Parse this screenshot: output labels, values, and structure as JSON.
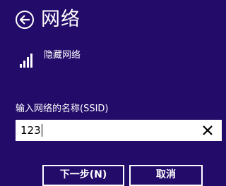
{
  "header": {
    "title": "网络",
    "back_icon": "back-arrow-icon"
  },
  "network": {
    "name": "隐藏网络",
    "signal_icon": "wifi-signal-icon"
  },
  "ssid_field": {
    "label": "输入网络的名称(SSID)",
    "value": "123",
    "clear_icon": "close-icon"
  },
  "buttons": {
    "next_label": "下一步(N)",
    "cancel_label": "取消"
  },
  "colors": {
    "background": "#230b69",
    "foreground": "#ffffff"
  }
}
